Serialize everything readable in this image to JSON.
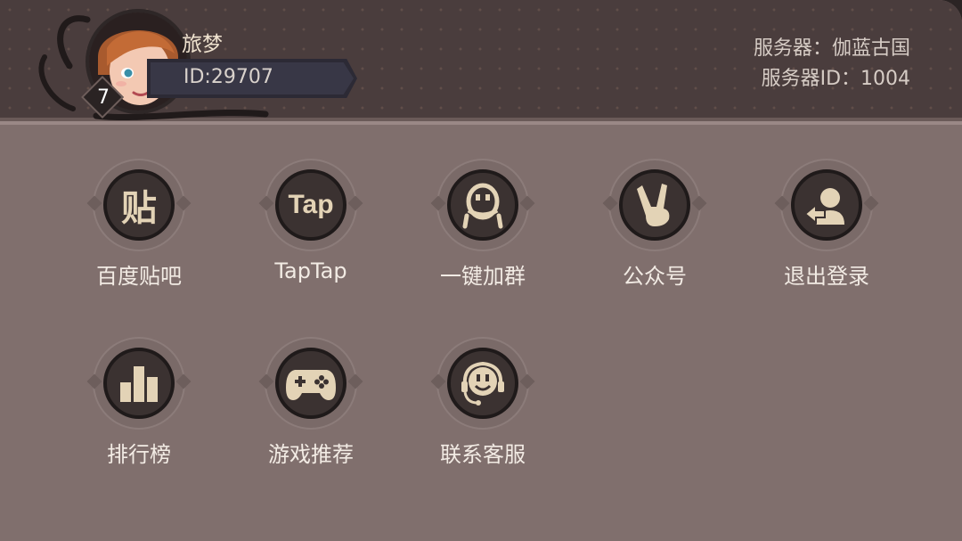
{
  "profile": {
    "username": "旅梦",
    "id_text": "ID:29707",
    "level": "7"
  },
  "server": {
    "name_text": "服务器：伽蓝古国",
    "id_text": "服务器ID：1004"
  },
  "menu": [
    {
      "label": "百度贴吧",
      "icon": "tieba-icon",
      "glyph": "贴"
    },
    {
      "label": "TapTap",
      "icon": "taptap-icon",
      "glyph": "Tap"
    },
    {
      "label": "一键加群",
      "icon": "qq-penguin-icon"
    },
    {
      "label": "公众号",
      "icon": "victory-hand-icon"
    },
    {
      "label": "退出登录",
      "icon": "logout-user-icon"
    },
    {
      "label": "排行榜",
      "icon": "bar-chart-icon"
    },
    {
      "label": "游戏推荐",
      "icon": "gamepad-icon"
    },
    {
      "label": "联系客服",
      "icon": "headset-smile-icon"
    }
  ],
  "colors": {
    "panel": "#806f6d",
    "header": "#4a3d3d",
    "icon_disc": "#3b3231",
    "icon_glyph": "#e3d3b6",
    "label": "#f2ebe4"
  }
}
